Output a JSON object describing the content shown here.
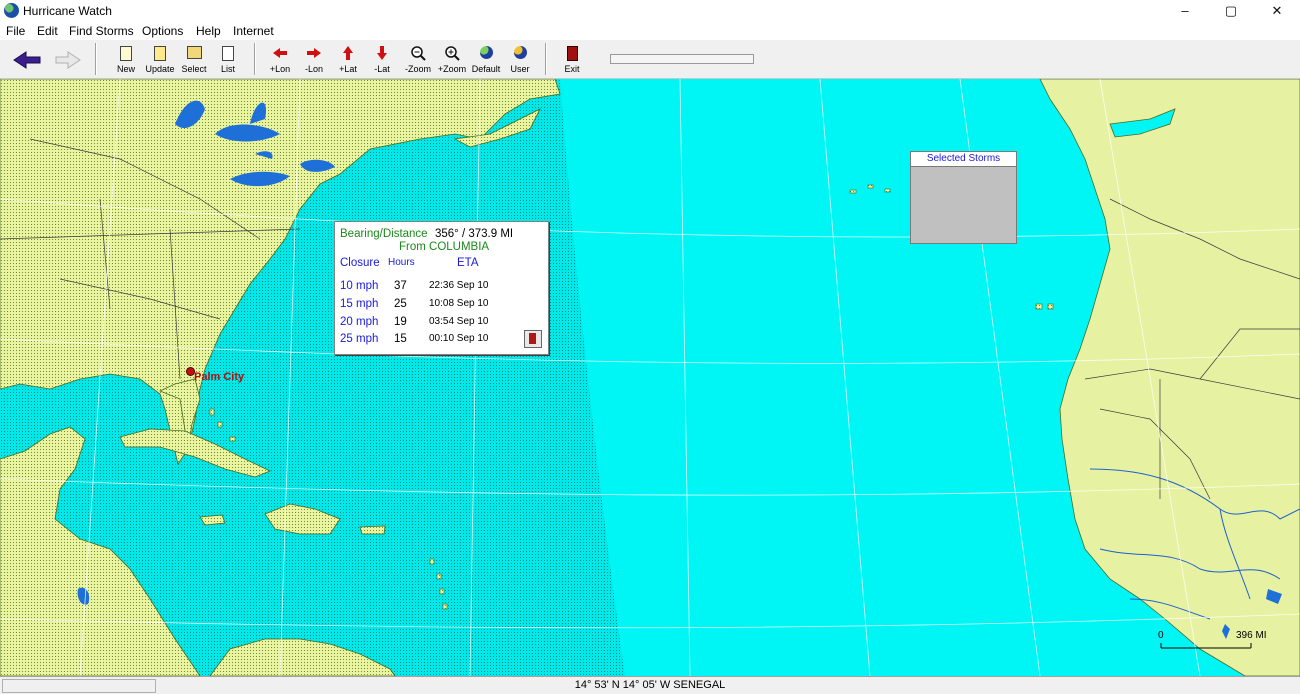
{
  "window": {
    "title": "Hurricane Watch",
    "min": "–",
    "max": "▢",
    "close": "✕"
  },
  "menu": [
    "File",
    "Edit",
    "Find Storms",
    "Options",
    "Help",
    "Internet"
  ],
  "toolbar": {
    "buttons": [
      {
        "label": "New",
        "icon": "new-doc-icon"
      },
      {
        "label": "Update",
        "icon": "update-doc-icon"
      },
      {
        "label": "Select",
        "icon": "select-folder-icon"
      },
      {
        "label": "List",
        "icon": "list-icon"
      },
      {
        "label": "+Lon",
        "icon": "arrow-left-icon"
      },
      {
        "label": "-Lon",
        "icon": "arrow-right-icon"
      },
      {
        "label": "+Lat",
        "icon": "arrow-up-icon"
      },
      {
        "label": "-Lat",
        "icon": "arrow-down-icon"
      },
      {
        "label": "-Zoom",
        "icon": "zoom-out-icon"
      },
      {
        "label": "+Zoom",
        "icon": "zoom-in-icon"
      },
      {
        "label": "Default",
        "icon": "globe-icon"
      },
      {
        "label": "User",
        "icon": "globe-user-icon"
      },
      {
        "label": "Exit",
        "icon": "exit-door-icon"
      }
    ]
  },
  "info_panel": {
    "bearing_label": "Bearing/Distance",
    "bearing_value": "356° / 373.9 MI",
    "from": "From COLUMBIA",
    "col_closure": "Closure",
    "col_hours": "Hours",
    "col_eta": "ETA",
    "rows": [
      {
        "speed": "10 mph",
        "hours": "37",
        "eta": "22:36 Sep 10"
      },
      {
        "speed": "15 mph",
        "hours": "25",
        "eta": "10:08 Sep 10"
      },
      {
        "speed": "20 mph",
        "hours": "19",
        "eta": "03:54 Sep 10"
      },
      {
        "speed": "25 mph",
        "hours": "15",
        "eta": "00:10 Sep 10"
      }
    ]
  },
  "selected_storms": {
    "title": "Selected Storms"
  },
  "map": {
    "city": "Palm City",
    "scale_start": "0",
    "scale_end": "396 MI",
    "colors": {
      "ocean": "#00f5f5",
      "land": "#e6f2a2",
      "lake": "#1f6fd8",
      "grid": "#ffffff"
    }
  },
  "status": {
    "text": "14° 53' N   14° 05' W  SENEGAL"
  }
}
